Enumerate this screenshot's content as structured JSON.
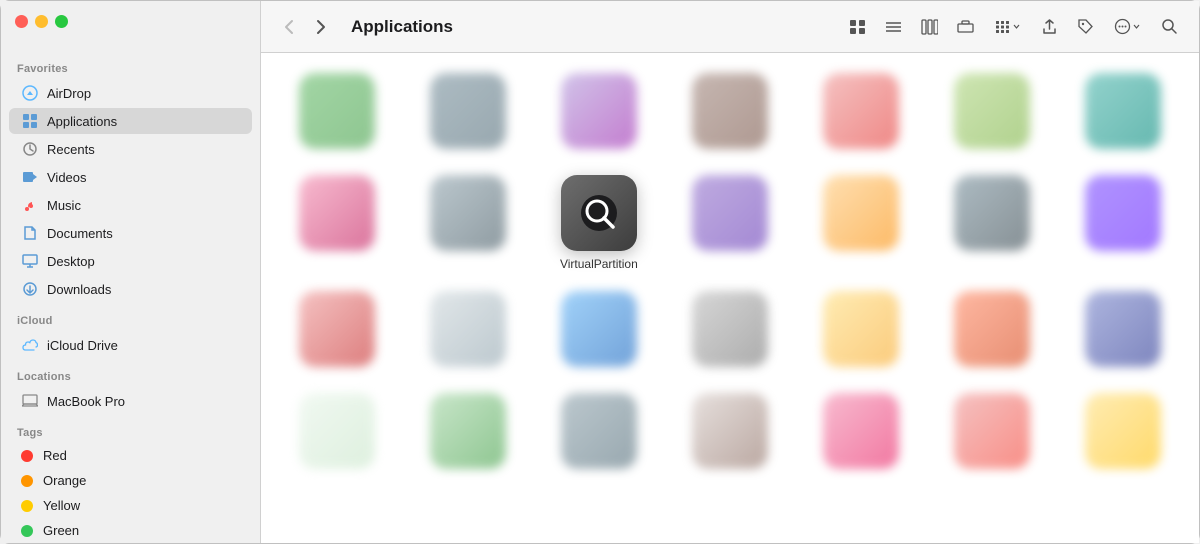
{
  "window": {
    "title": "Applications"
  },
  "windowControls": {
    "close_color": "#ff5f57",
    "minimize_color": "#ffbd2e",
    "maximize_color": "#28c840"
  },
  "toolbar": {
    "title": "Applications",
    "back_label": "‹",
    "forward_label": "›"
  },
  "sidebar": {
    "sections": [
      {
        "label": "Favorites",
        "items": [
          {
            "id": "airdrop",
            "label": "AirDrop",
            "icon": "airdrop"
          },
          {
            "id": "applications",
            "label": "Applications",
            "icon": "applications",
            "active": true
          },
          {
            "id": "recents",
            "label": "Recents",
            "icon": "recents"
          },
          {
            "id": "videos",
            "label": "Videos",
            "icon": "videos"
          },
          {
            "id": "music",
            "label": "Music",
            "icon": "music"
          },
          {
            "id": "documents",
            "label": "Documents",
            "icon": "documents"
          },
          {
            "id": "desktop",
            "label": "Desktop",
            "icon": "desktop"
          },
          {
            "id": "downloads",
            "label": "Downloads",
            "icon": "downloads"
          }
        ]
      },
      {
        "label": "iCloud",
        "items": [
          {
            "id": "icloud-drive",
            "label": "iCloud Drive",
            "icon": "icloud"
          }
        ]
      },
      {
        "label": "Locations",
        "items": [
          {
            "id": "macbook-pro",
            "label": "MacBook Pro",
            "icon": "laptop"
          }
        ]
      },
      {
        "label": "Tags",
        "items": [
          {
            "id": "tag-red",
            "label": "Red",
            "color": "#ff3b30"
          },
          {
            "id": "tag-orange",
            "label": "Orange",
            "color": "#ff9500"
          },
          {
            "id": "tag-yellow",
            "label": "Yellow",
            "color": "#ffcc00"
          },
          {
            "id": "tag-green",
            "label": "Green",
            "color": "#34c759"
          }
        ]
      }
    ]
  },
  "focused_app": {
    "label": "VirtualPartition",
    "icon": "search-circle"
  },
  "app_grid": {
    "rows": [
      [
        "app1",
        "app2",
        "app3",
        "app4",
        "app5",
        "app6",
        "app7"
      ],
      [
        "app8",
        "app9",
        "virtual",
        "app10",
        "app11",
        "app12",
        "app13"
      ],
      [
        "app14",
        "app15",
        "app16",
        "app17",
        "app18",
        "app19",
        "app20"
      ],
      [
        "app21",
        "app22",
        "app23",
        "app24",
        "app25",
        "app26",
        "app27"
      ]
    ],
    "colors": {
      "app1": "#4caf50",
      "app2": "#607d8b",
      "app3": "#9c27b0",
      "app4": "#795548",
      "app5": "#f44336",
      "app6": "#8bc34a",
      "app7": "#009688",
      "app8": "#e91e63",
      "app9": "#455a64",
      "app10": "#673ab7",
      "app11": "#ff9800",
      "app12": "#546e7a",
      "app13": "#7c4dff",
      "app14": "#d32f2f",
      "app15": "#b0bec5",
      "app16": "#2196f3",
      "app17": "#9e9e9e",
      "app18": "#ffc107",
      "app19": "#ff5722",
      "app20": "#3f51b5",
      "app21": "#c8e6c9",
      "app22": "#a5d6a7",
      "app23": "#78909c",
      "app24": "#bcaaa4",
      "app25": "#f48fb1",
      "app26": "#ef9a9a",
      "app27": "#ffe082"
    }
  }
}
